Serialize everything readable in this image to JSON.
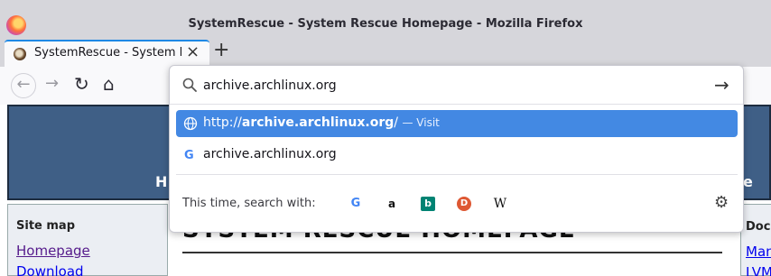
{
  "window": {
    "title": "SystemRescue - System Rescue Homepage - Mozilla Firefox"
  },
  "tab": {
    "title": "SystemRescue - System Rescue Homepage",
    "close": "×",
    "new_tab": "+"
  },
  "nav": {
    "back": "←",
    "forward": "→",
    "reload": "↻",
    "home": "⌂"
  },
  "urlbar": {
    "value": "archive.archlinux.org",
    "go": "→",
    "suggestions": [
      {
        "prefix": "http://",
        "bold": "archive.archlinux.org",
        "suffix": "/",
        "action": "— Visit"
      },
      {
        "text": "archive.archlinux.org"
      }
    ],
    "one_off_label": "This time, search with:",
    "engines": [
      {
        "name": "google",
        "glyph": "G"
      },
      {
        "name": "amazon",
        "glyph": "a"
      },
      {
        "name": "bing",
        "glyph": "b"
      },
      {
        "name": "duckduckgo",
        "glyph": "D"
      },
      {
        "name": "wikipedia",
        "glyph": "W"
      }
    ],
    "settings": "⚙"
  },
  "page": {
    "header_left": "H",
    "header_right": "e",
    "sidebar": {
      "title": "Site map",
      "links": [
        "Homepage",
        "Download"
      ]
    },
    "main_title": "SYSTEM RESCUE HOMEPAGE",
    "right": {
      "title": "Docu",
      "links": [
        "Man",
        "LVM"
      ]
    }
  },
  "colors": {
    "accent": "#0061e0",
    "header_bg": "#3f5f86",
    "visited_link": "#551a8b",
    "link": "#0000ee"
  }
}
